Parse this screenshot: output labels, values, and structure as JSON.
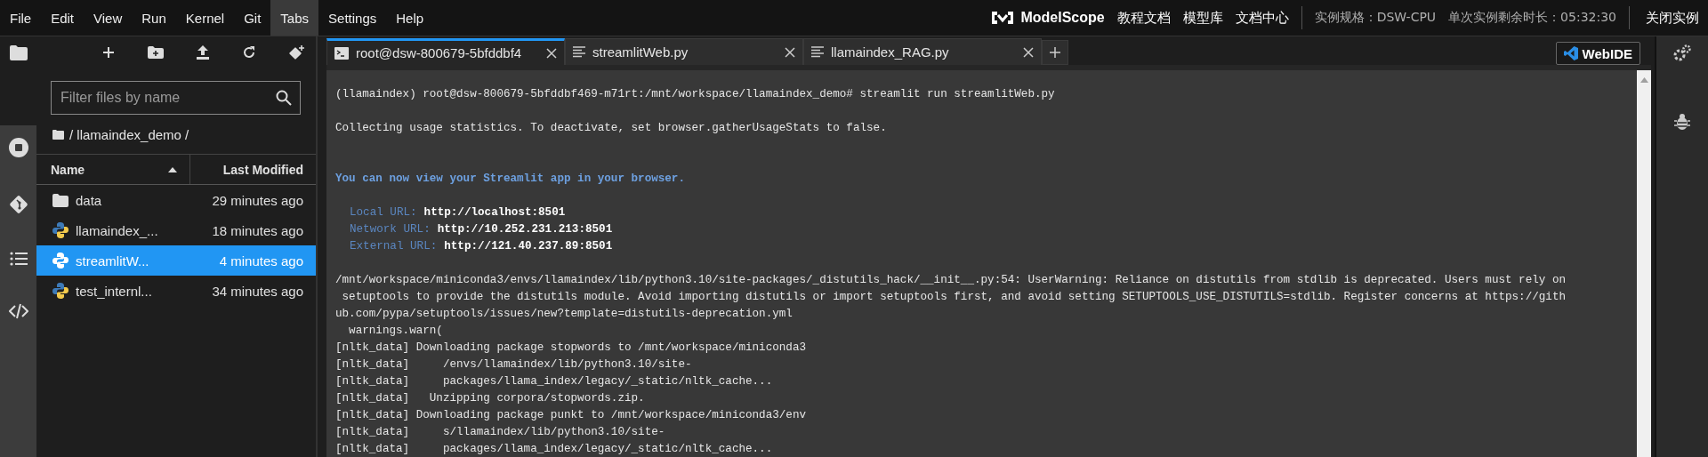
{
  "menu_bar": {
    "items": [
      {
        "label": "File",
        "selected": false
      },
      {
        "label": "Edit",
        "selected": false
      },
      {
        "label": "View",
        "selected": false
      },
      {
        "label": "Run",
        "selected": false
      },
      {
        "label": "Kernel",
        "selected": false
      },
      {
        "label": "Git",
        "selected": false
      },
      {
        "label": "Tabs",
        "selected": true
      },
      {
        "label": "Settings",
        "selected": false
      },
      {
        "label": "Help",
        "selected": false
      }
    ],
    "logo": "ModelScope",
    "links": [
      "教程文档",
      "模型库",
      "文档中心"
    ],
    "instance_spec": "实例规格：DSW-CPU",
    "remaining_time": "单次实例剩余时长：05:32:30",
    "close_instance": "关闭实例"
  },
  "file_browser": {
    "search": {
      "placeholder": "Filter files by name"
    },
    "breadcrumb": "/ llamaindex_demo /",
    "columns": [
      "Name",
      "Last Modified"
    ],
    "rows": [
      {
        "kind": "folder",
        "name": "data",
        "modified": "29 minutes ago",
        "selected": false
      },
      {
        "kind": "python",
        "name": "llamaindex_...",
        "modified": "18 minutes ago",
        "selected": false
      },
      {
        "kind": "python",
        "name": "streamlitW...",
        "modified": "4 minutes ago",
        "selected": true
      },
      {
        "kind": "python",
        "name": "test_internl...",
        "modified": "34 minutes ago",
        "selected": false
      }
    ]
  },
  "tabs": [
    {
      "kind": "terminal",
      "label": "root@dsw-800679-5bfddbf4",
      "selected": true
    },
    {
      "kind": "file",
      "label": "streamlitWeb.py",
      "selected": false
    },
    {
      "kind": "file",
      "label": "llamaindex_RAG.py",
      "selected": false
    }
  ],
  "webide_button": "WebIDE",
  "terminal": {
    "blocks": [
      {
        "kind": "plain",
        "lines": [
          "(llamaindex) root@dsw-800679-5bfddbf469-m71rt:/mnt/workspace/llamaindex_demo# streamlit run streamlitWeb.py"
        ]
      },
      {
        "kind": "plain",
        "lines": [
          "Collecting usage statistics. To deactivate, set browser.gatherUsageStats to false."
        ]
      },
      {
        "kind": "notice",
        "lines": [
          "You can now view your Streamlit app in your browser."
        ]
      },
      {
        "kind": "urls",
        "urls": [
          {
            "label": "Local URL:",
            "url": "http://localhost:8501"
          },
          {
            "label": "Network URL:",
            "url": "http://10.252.231.213:8501"
          },
          {
            "label": "External URL:",
            "url": "http://121.40.237.89:8501"
          }
        ]
      },
      {
        "kind": "plain",
        "lines": [
          "/mnt/workspace/miniconda3/envs/llamaindex/lib/python3.10/site-packages/_distutils_hack/__init__.py:54: UserWarning: Reliance on distutils from stdlib is deprecated. Users must rely on",
          " setuptools to provide the distutils module. Avoid importing distutils or import setuptools first, and avoid setting SETUPTOOLS_USE_DISTUTILS=stdlib. Register concerns at https://gith",
          "ub.com/pypa/setuptools/issues/new?template=distutils-deprecation.yml",
          "  warnings.warn(",
          "[nltk_data] Downloading package stopwords to /mnt/workspace/miniconda3",
          "[nltk_data]     /envs/llamaindex/lib/python3.10/site-",
          "[nltk_data]     packages/llama_index/legacy/_static/nltk_cache...",
          "[nltk_data]   Unzipping corpora/stopwords.zip.",
          "[nltk_data] Downloading package punkt to /mnt/workspace/miniconda3/env",
          "[nltk_data]     s/llamaindex/lib/python3.10/site-",
          "[nltk_data]     packages/llama_index/legacy/_static/nltk_cache..."
        ]
      }
    ]
  }
}
